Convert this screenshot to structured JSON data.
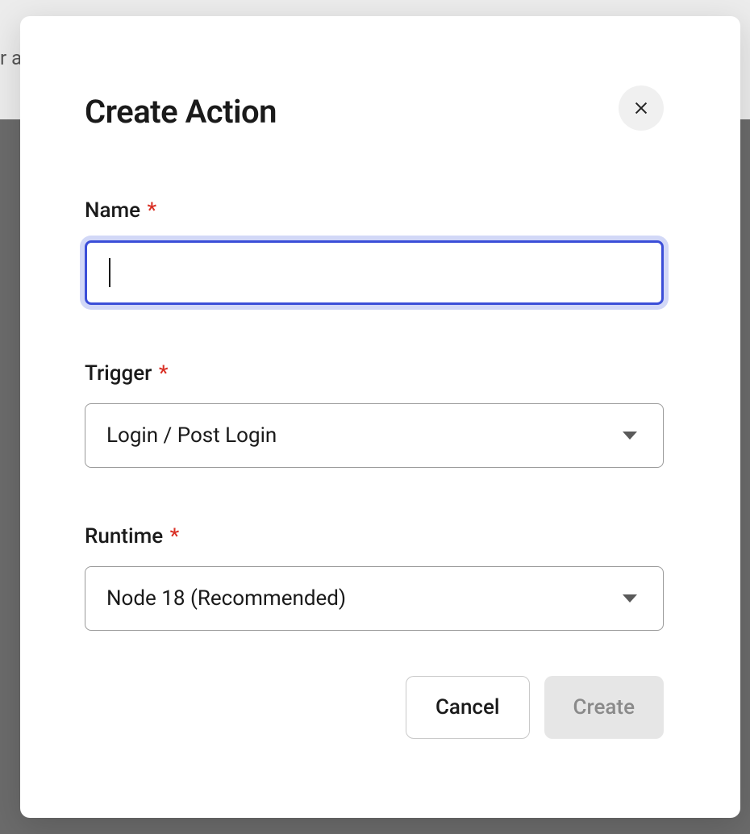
{
  "background": {
    "partial_text": "r a"
  },
  "modal": {
    "title": "Create Action",
    "fields": {
      "name": {
        "label": "Name",
        "required_marker": "*",
        "value": ""
      },
      "trigger": {
        "label": "Trigger",
        "required_marker": "*",
        "selected": "Login / Post Login"
      },
      "runtime": {
        "label": "Runtime",
        "required_marker": "*",
        "selected": "Node 18 (Recommended)"
      }
    },
    "footer": {
      "cancel_label": "Cancel",
      "create_label": "Create"
    }
  }
}
